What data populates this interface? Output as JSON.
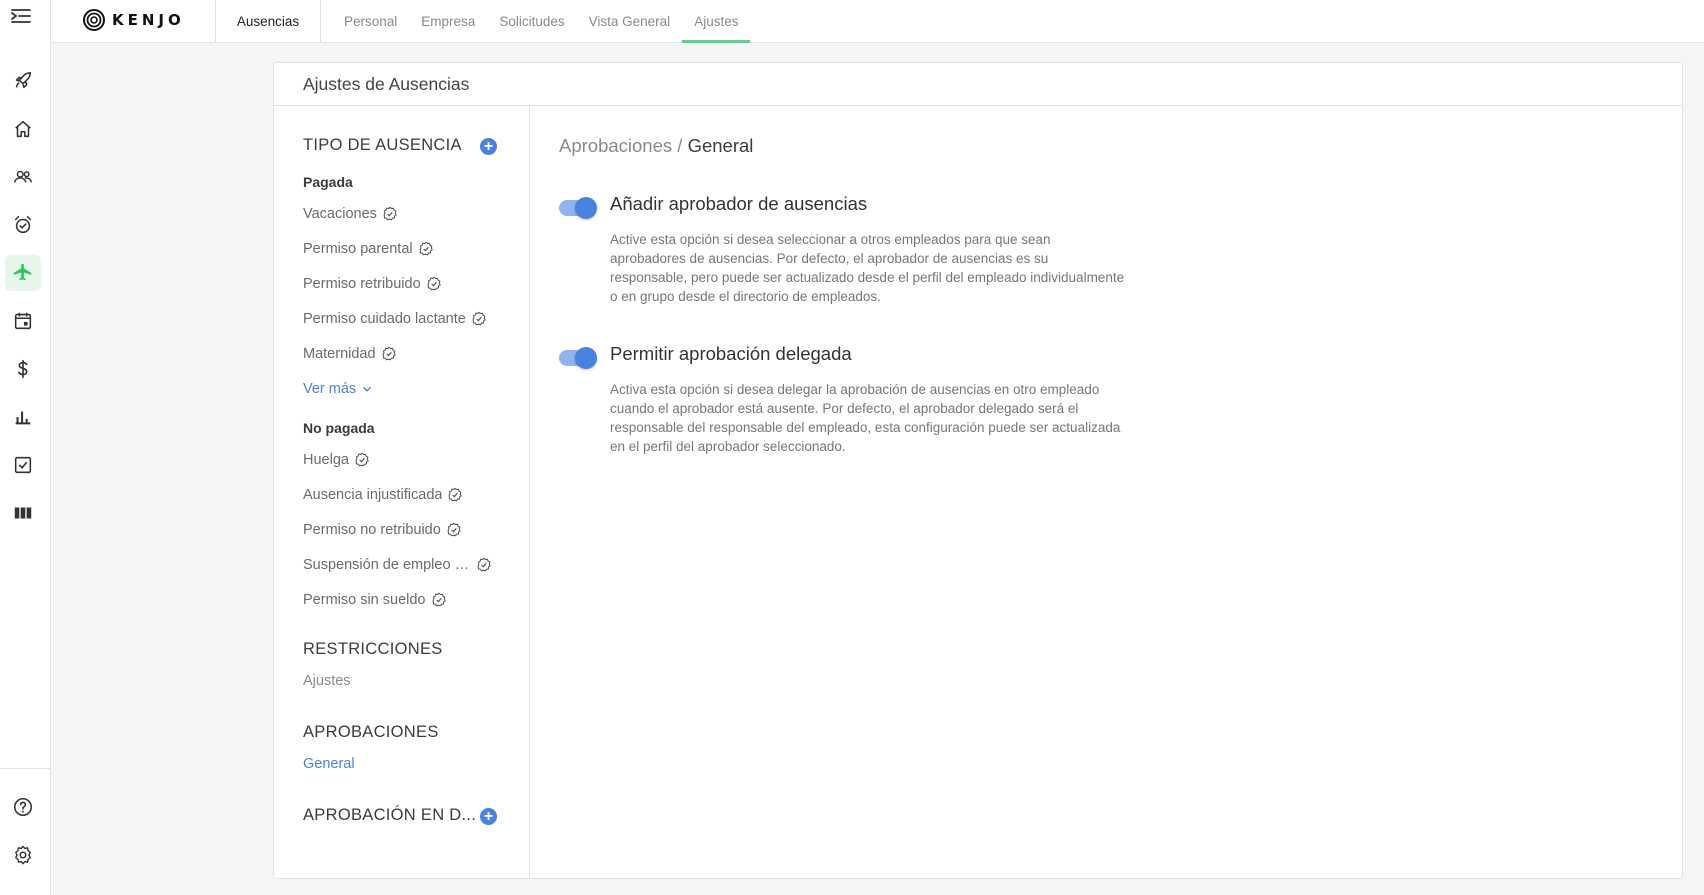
{
  "brand": {
    "name": "KENJO"
  },
  "module_tab": "Ausencias",
  "subtabs": [
    "Personal",
    "Empresa",
    "Solicitudes",
    "Vista General",
    "Ajustes"
  ],
  "active_subtab": "Ajustes",
  "sidebar_icons": [
    "rocket-icon",
    "home-icon",
    "people-icon",
    "alarm-clock-icon",
    "airplane-icon",
    "calendar-icon",
    "dollar-icon",
    "bar-chart-icon",
    "checklist-icon",
    "columns-icon",
    "help-icon",
    "gear-icon"
  ],
  "active_sidebar_icon": "airplane-icon",
  "accent_color": "#4a82e0",
  "active_tab_color": "#5fd08b",
  "card_title": "Ajustes de Ausencias",
  "left_panel": {
    "tipo_header": "TIPO DE AUSENCIA",
    "paid_label": "Pagada",
    "paid_items": [
      "Vacaciones",
      "Permiso parental",
      "Permiso retribuido",
      "Permiso cuidado lactante",
      "Maternidad"
    ],
    "ver_mas": "Ver más",
    "unpaid_label": "No pagada",
    "unpaid_items": [
      "Huelga",
      "Ausencia injustificada",
      "Permiso no retribuido",
      "Suspensión de empleo y sueldo",
      "Permiso sin sueldo"
    ],
    "restricciones_header": "RESTRICCIONES",
    "restricciones_item": "Ajustes",
    "aprobaciones_header": "APROBACIONES",
    "aprobaciones_item": "General",
    "delegated_header": "APROBACIÓN EN D..."
  },
  "breadcrumb": {
    "parent": "Aprobaciones",
    "separator": "/",
    "current": "General"
  },
  "settings": [
    {
      "title": "Añadir aprobador de ausencias",
      "enabled": true,
      "description": "Active esta opción si desea seleccionar a otros empleados para que sean aprobadores de ausencias. Por defecto, el aprobador de ausencias es su responsable, pero puede ser actualizado desde el perfil del empleado individualmente o en grupo desde el directorio de empleados."
    },
    {
      "title": "Permitir aprobación delegada",
      "enabled": true,
      "description": "Activa esta opción si desea delegar la aprobación de ausencias en otro empleado cuando el aprobador está ausente. Por defecto, el aprobador delegado será el responsable del responsable del empleado, esta configuración puede ser actualizada en el perfil del aprobador seleccionado."
    }
  ]
}
